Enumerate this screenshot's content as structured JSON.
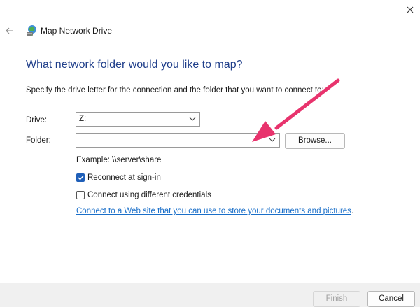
{
  "window": {
    "title": "Map Network Drive",
    "icons": {
      "close": "close-icon",
      "back": "back-arrow-icon",
      "app": "network-drive-icon"
    }
  },
  "main": {
    "heading": "What network folder would you like to map?",
    "instruction": "Specify the drive letter for the connection and the folder that you want to connect to:",
    "drive": {
      "label": "Drive:",
      "value": "Z:"
    },
    "folder": {
      "label": "Folder:",
      "value": "",
      "browse_label": "Browse..."
    },
    "example": "Example: \\\\server\\share",
    "reconnect": {
      "label": "Reconnect at sign-in",
      "checked": true
    },
    "credentials": {
      "label": "Connect using different credentials",
      "checked": false
    },
    "link": {
      "text": "Connect to a Web site that you can use to store your documents and pictures",
      "suffix": "."
    }
  },
  "footer": {
    "finish_label": "Finish",
    "cancel_label": "Cancel"
  },
  "colors": {
    "heading": "#1f3e8a",
    "link": "#1a6fc9",
    "checkbox_checked": "#1f5fb8",
    "annotation_arrow": "#e8336d"
  }
}
